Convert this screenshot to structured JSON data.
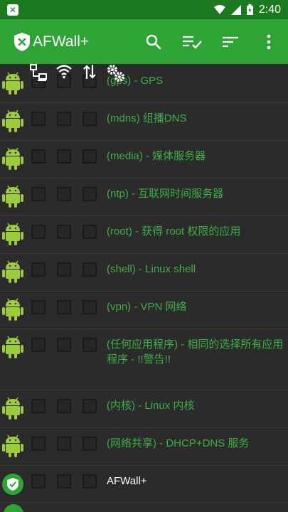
{
  "status_bar": {
    "time": "2:40",
    "icons": [
      "notification-icon",
      "wifi-icon",
      "signal-icon",
      "battery-icon"
    ]
  },
  "toolbar": {
    "title": "AFWall+",
    "actions": [
      "search-icon",
      "select-all-icon",
      "sort-icon",
      "more-icon"
    ]
  },
  "column_headers": [
    "lan-icon",
    "wifi-icon",
    "data-icon",
    "settings-icon"
  ],
  "apps": [
    {
      "label": "(gps) - GPS",
      "icon": "android-icon"
    },
    {
      "label": "(mdns) 组播DNS",
      "icon": "android-icon"
    },
    {
      "label": "(media) - 媒体服务器",
      "icon": "android-icon"
    },
    {
      "label": "(ntp) - 互联网时间服务器",
      "icon": "android-icon"
    },
    {
      "label": "(root) - 获得 root 权限的应用",
      "icon": "android-icon"
    },
    {
      "label": "(shell) - Linux shell",
      "icon": "android-icon"
    },
    {
      "label": "(vpn) - VPN 网络",
      "icon": "android-icon"
    },
    {
      "label": "(任何应用程序) - 相同的选择所有应用程序 - !!警告!!",
      "icon": "android-icon"
    },
    {
      "label": "(内核) - Linux 内核",
      "icon": "android-icon"
    },
    {
      "label": "(网络共享) - DHCP+DNS 服务",
      "icon": "android-icon"
    },
    {
      "label": "AFWall+",
      "icon": "afwall-icon"
    }
  ],
  "colors": {
    "status_bar": "#1b7a1f",
    "toolbar": "#2ea436",
    "accent_text": "#3fae46",
    "background": "#2b2b2b"
  }
}
